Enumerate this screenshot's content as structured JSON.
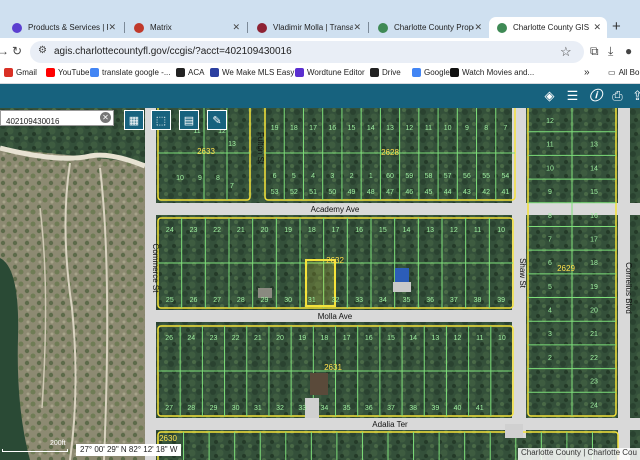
{
  "browser": {
    "tabs": [
      {
        "label": "Products & Services | Pul",
        "favicon_color": "#5b3fd0",
        "active": false
      },
      {
        "label": "Matrix",
        "favicon_color": "#c0392b",
        "active": false
      },
      {
        "label": "Vladimir Molla | Transacti",
        "favicon_color": "#8e2233",
        "active": false
      },
      {
        "label": "Charlotte County Propert",
        "favicon_color": "#3f8a55",
        "active": false
      },
      {
        "label": "Charlotte County GIS",
        "favicon_color": "#3f8a55",
        "active": true
      }
    ],
    "new_tab_label": "+",
    "url": "agis.charlottecountyfl.gov/ccgis/?acct=402109430016",
    "bookmarks": [
      {
        "label": "Gmail",
        "icon_color": "#d93025"
      },
      {
        "label": "YouTube",
        "icon_color": "#ff0000"
      },
      {
        "label": "translate google -...",
        "icon_color": "#4285f4"
      },
      {
        "label": "ACA",
        "icon_color": "#222222"
      },
      {
        "label": "We Make MLS Easy",
        "icon_color": "#2b3fa0"
      },
      {
        "label": "Wordtune Editor",
        "icon_color": "#5b2fd0"
      },
      {
        "label": "Drive",
        "icon_color": "#222222"
      },
      {
        "label": "Google",
        "icon_color": "#4285f4"
      },
      {
        "label": "Watch Movies and...",
        "icon_color": "#111111"
      }
    ],
    "bookmarks_overflow": "»",
    "all_bookmarks_label": "All Bo"
  },
  "app": {
    "header_color": "#17627e",
    "header_icons": [
      "layers-icon",
      "list-icon",
      "info-icon",
      "print-icon",
      "share-icon"
    ]
  },
  "map": {
    "search_value": "402109430016",
    "tool_icons": [
      "basemap-grid-icon",
      "select-box-icon",
      "notes-icon",
      "draw-pencil-icon"
    ],
    "coordinates": "27° 00' 29\" N 82° 12' 18\" W",
    "scale_label": "200ft",
    "attribution": "Charlotte County | Charlotte Cou",
    "streets": [
      {
        "name": "Academy Ave",
        "orientation": "horizontal"
      },
      {
        "name": "Molla Ave",
        "orientation": "horizontal"
      },
      {
        "name": "Adalia Ter",
        "orientation": "horizontal"
      },
      {
        "name": "Commerce St",
        "orientation": "vertical"
      },
      {
        "name": "Fulton St",
        "orientation": "vertical"
      },
      {
        "name": "Shaw St",
        "orientation": "vertical"
      },
      {
        "name": "Cornelius Blvd",
        "orientation": "vertical"
      }
    ],
    "block_numbers": [
      "2633",
      "2628",
      "2632",
      "2629",
      "2631",
      "2630"
    ],
    "highlighted_parcel_color": "#f5e33a",
    "parcel_line_color": "#7ee07a",
    "block_outline_color": "#f5e33a",
    "road_color": "#d9d9d9",
    "lots": {
      "block_2628": [
        "19",
        "18",
        "17",
        "16",
        "15",
        "14",
        "13",
        "12",
        "11",
        "10",
        "9",
        "8",
        "7",
        "6",
        "5",
        "4",
        "3",
        "2",
        "1",
        "60",
        "59",
        "58",
        "57",
        "56",
        "55",
        "54",
        "53",
        "52",
        "51",
        "50",
        "49",
        "48",
        "47",
        "46",
        "45",
        "44",
        "43",
        "42",
        "41"
      ],
      "block_2632_top": [
        "24",
        "23",
        "22",
        "21",
        "20",
        "19",
        "18",
        "17",
        "16",
        "15",
        "14",
        "13",
        "12",
        "11",
        "10"
      ],
      "block_2632_bottom": [
        "25",
        "26",
        "27",
        "28",
        "29",
        "30",
        "31",
        "32",
        "33",
        "34",
        "35",
        "36",
        "37",
        "38",
        "39"
      ],
      "block_2631_top": [
        "26",
        "24",
        "23",
        "22",
        "21",
        "20",
        "19",
        "18",
        "17",
        "16",
        "15",
        "14",
        "13",
        "12",
        "11",
        "10"
      ],
      "block_2631_bottom": [
        "27",
        "28",
        "29",
        "30",
        "31",
        "32",
        "33",
        "34",
        "35",
        "36",
        "37",
        "38",
        "39",
        "40",
        "41"
      ],
      "block_2629_east": [
        "13",
        "14",
        "15",
        "16",
        "17",
        "18",
        "19",
        "20",
        "21",
        "22",
        "23",
        "24"
      ],
      "block_2629_west": [
        "12",
        "11",
        "10",
        "9",
        "8",
        "7",
        "6",
        "5",
        "4",
        "3",
        "2"
      ],
      "block_2633": [
        "11",
        "12",
        "13",
        "10",
        "9",
        "8",
        "7"
      ]
    }
  }
}
